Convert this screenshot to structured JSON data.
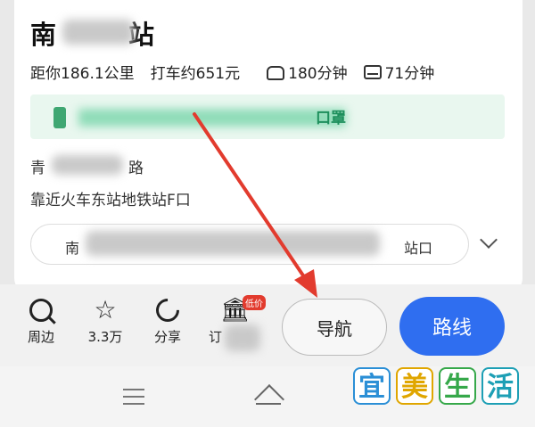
{
  "place": {
    "title_prefix": "南",
    "title_suffix": "站",
    "distance": "距你186.1公里",
    "taxi": "打车约651元",
    "drive_time": "180分钟",
    "transit_time": "71分钟"
  },
  "banner": {
    "tail": "口罩"
  },
  "address": {
    "line1_prefix": "青",
    "line1_suffix": "路",
    "line2": "靠近火车东站地铁站F口"
  },
  "entrance": {
    "prefix": "南",
    "suffix": "站口"
  },
  "actions": {
    "nearby": "周边",
    "favorite": "3.3万",
    "share": "分享",
    "ticket_prefix": "订",
    "ticket_tag": "低价"
  },
  "buttons": {
    "navigate": "导航",
    "route": "路线"
  },
  "watermark": [
    "宜",
    "美",
    "生",
    "活"
  ],
  "colors": {
    "route_button": "#2f6ef0",
    "arrow": "#e23b2e",
    "banner_bg": "#e9f7ef"
  }
}
